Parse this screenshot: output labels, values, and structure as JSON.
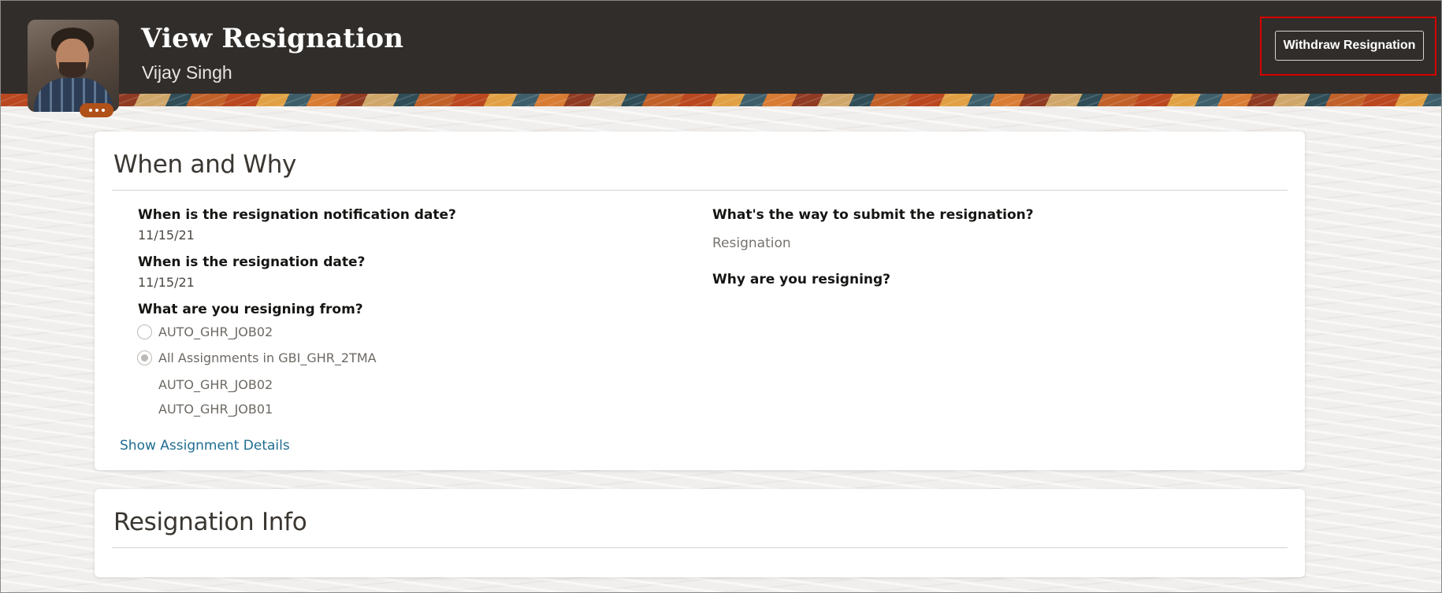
{
  "header": {
    "title": "View Resignation",
    "person_name": "Vijay Singh",
    "withdraw_button_label": "Withdraw Resignation",
    "avatar_icon": "user-photo",
    "more_icon": "more-horizontal-icon"
  },
  "when_and_why": {
    "title": "When and Why",
    "notification_date_label": "When is the resignation notification date?",
    "notification_date_value": "11/15/21",
    "resignation_date_label": "When is the resignation date?",
    "resignation_date_value": "11/15/21",
    "resigning_from_label": "What are you resigning from?",
    "options": [
      {
        "label": "AUTO_GHR_JOB02",
        "selected": false
      },
      {
        "label": "All Assignments in GBI_GHR_2TMA",
        "selected": true
      }
    ],
    "assignments": [
      "AUTO_GHR_JOB02",
      "AUTO_GHR_JOB01"
    ],
    "show_details_link": "Show Assignment Details",
    "submit_way_label": "What's the way to submit the resignation?",
    "submit_way_value": "Resignation",
    "why_label": "Why are you resigning?"
  },
  "resignation_info": {
    "title": "Resignation Info"
  },
  "colors": {
    "header_bg": "#312d2a",
    "highlight": "#d60000",
    "link": "#1f6d91",
    "avatar_badge": "#b0511a"
  }
}
